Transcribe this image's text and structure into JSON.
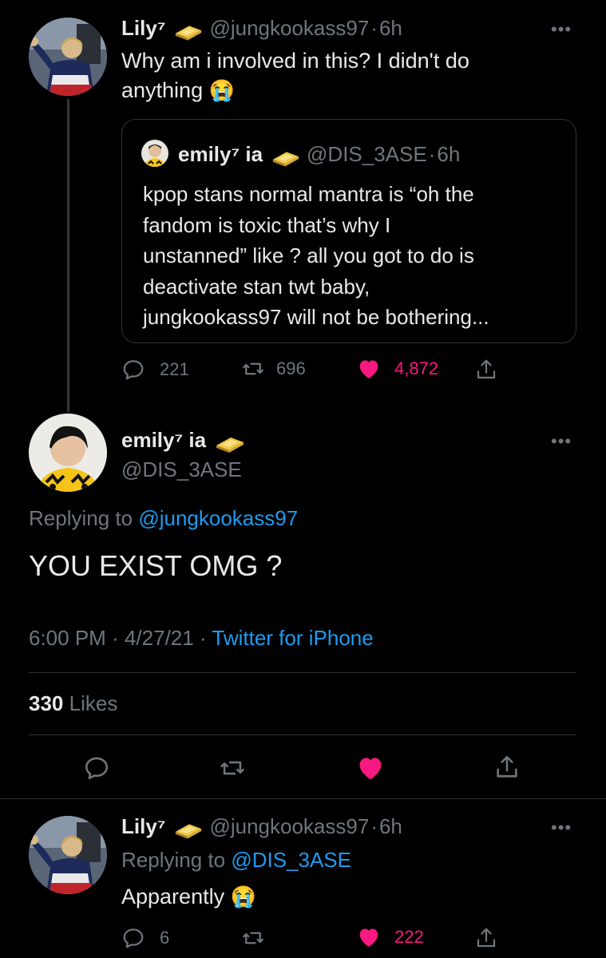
{
  "tweet1": {
    "name": "Lily⁷",
    "handle": "@jungkookass97",
    "time": "6h",
    "text_line1": "Why am i involved in this? I didn't do",
    "text_line2": "anything",
    "emoji": "😭",
    "quote": {
      "name": "emily⁷ ia",
      "handle": "@DIS_3ASE",
      "time": "6h",
      "lines": [
        "kpop stans normal mantra is “oh the",
        "fandom is toxic that’s why I",
        "unstanned” like ? all you got to do is",
        "deactivate stan twt baby,",
        "jungkookass97 will not be bothering..."
      ]
    },
    "replies": "221",
    "retweets": "696",
    "likes": "4,872"
  },
  "main": {
    "name": "emily⁷ ia",
    "handle": "@DIS_3ASE",
    "replying_prefix": "Replying to",
    "replying_to": "@jungkookass97",
    "text": "YOU EXIST OMG ?",
    "time": "6:00 PM",
    "date": "4/27/21",
    "source": "Twitter for iPhone",
    "likes_count": "330",
    "likes_label": "Likes"
  },
  "reply": {
    "name": "Lily⁷",
    "handle": "@jungkookass97",
    "time": "6h",
    "replying_prefix": "Replying to",
    "replying_to": "@DIS_3ASE",
    "text": "Apparently",
    "emoji": "😭",
    "replies": "6",
    "likes": "222"
  },
  "separator": "·",
  "more": "•••",
  "colors": {
    "background": "#000000",
    "text": "#e7e9ea",
    "muted": "#6e767d",
    "link": "#1d9bf0",
    "like": "#f91880",
    "divider": "#2f3336"
  },
  "icons": [
    "reply-icon",
    "retweet-icon",
    "heart-icon",
    "share-icon",
    "gold-bar-icon",
    "more-icon"
  ]
}
